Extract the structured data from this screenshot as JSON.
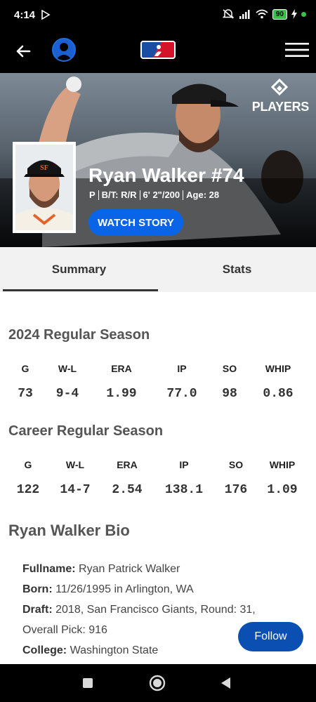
{
  "status_bar": {
    "time": "4:14",
    "battery": "90"
  },
  "nav": {
    "back_icon": "arrow-left-icon",
    "avatar_icon": "user-avatar-icon",
    "logo_icon": "mlb-logo-icon",
    "menu_icon": "hamburger-menu-icon"
  },
  "hero": {
    "brand_text": "PLAYERS",
    "player_name": "Ryan Walker #74",
    "position": "P",
    "bats_throws": "B/T: R/R",
    "height_weight": "6' 2\"/200",
    "age": "Age: 28",
    "watch_story": "WATCH STORY"
  },
  "tabs": [
    {
      "label": "Summary",
      "active": true
    },
    {
      "label": "Stats",
      "active": false
    }
  ],
  "season": {
    "title": "2024 Regular Season",
    "headers": [
      "G",
      "W-L",
      "ERA",
      "IP",
      "SO",
      "WHIP"
    ],
    "values": [
      "73",
      "9-4",
      "1.99",
      "77.0",
      "98",
      "0.86"
    ]
  },
  "career": {
    "title": "Career Regular Season",
    "headers": [
      "G",
      "W-L",
      "ERA",
      "IP",
      "SO",
      "WHIP"
    ],
    "values": [
      "122",
      "14-7",
      "2.54",
      "138.1",
      "176",
      "1.09"
    ]
  },
  "bio": {
    "title": "Ryan Walker Bio",
    "fullname_label": "Fullname:",
    "fullname": "Ryan Patrick Walker",
    "born_label": "Born:",
    "born": "11/26/1995 in Arlington, WA",
    "draft_label": "Draft:",
    "draft_line1": "2018, San Francisco Giants, Round: 31,",
    "draft_line2": "Overall Pick: 916",
    "college_label": "College:",
    "college": "Washington State"
  },
  "follow_button": "Follow",
  "colors": {
    "accent_blue": "#0a64e8",
    "follow_blue": "#0b4fb3",
    "battery_green": "#35c24a"
  }
}
